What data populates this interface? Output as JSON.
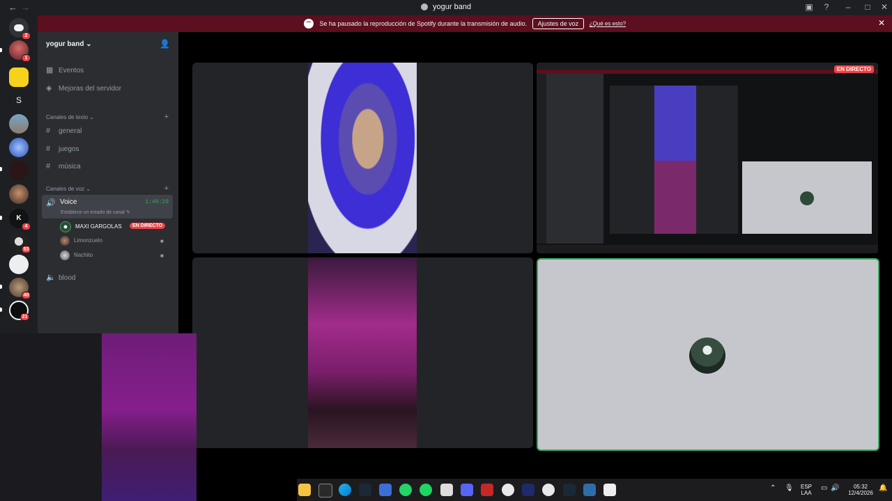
{
  "window": {
    "title": "yogur band",
    "back": "←",
    "forward": "→"
  },
  "banner": {
    "message": "Se ha pausado la reproducción de Spotify durante la transmisión de audio.",
    "button": "Ajustes de voz",
    "link": "¿Qué es esto?"
  },
  "sidebar": {
    "home_badge": "2",
    "server_badges": [
      "1",
      "4",
      "53",
      "40",
      "21"
    ],
    "s_letter": "S"
  },
  "server": {
    "name": "yogur band",
    "items": [
      {
        "label": "Eventos"
      },
      {
        "label": "Mejoras del servidor"
      }
    ],
    "text_category": "Canales de texto",
    "text_channels": [
      "general",
      "juegos",
      "música"
    ],
    "voice_category": "Canales de voz",
    "voice_channel": {
      "name": "Voice",
      "status_placeholder": "Establece un estado de canal",
      "timer": "1:49:29"
    },
    "members": [
      {
        "name": "MAXI GARGOLAS",
        "badge": "EN DIRECTO"
      },
      {
        "name": "Limonzuelo"
      },
      {
        "name": "Nachito"
      }
    ],
    "other_voice_channel": "blood"
  },
  "stage": {
    "screen_live_tag": "EN DIRECTO"
  },
  "taskbar": {
    "language": "ESP",
    "language_sub": "LAA",
    "time": "05:32",
    "date": "12/4/2026"
  },
  "colors": {
    "accent_red": "#ed4245",
    "voice_green": "#3ba55d",
    "banner_bg": "#5c0f1e"
  }
}
